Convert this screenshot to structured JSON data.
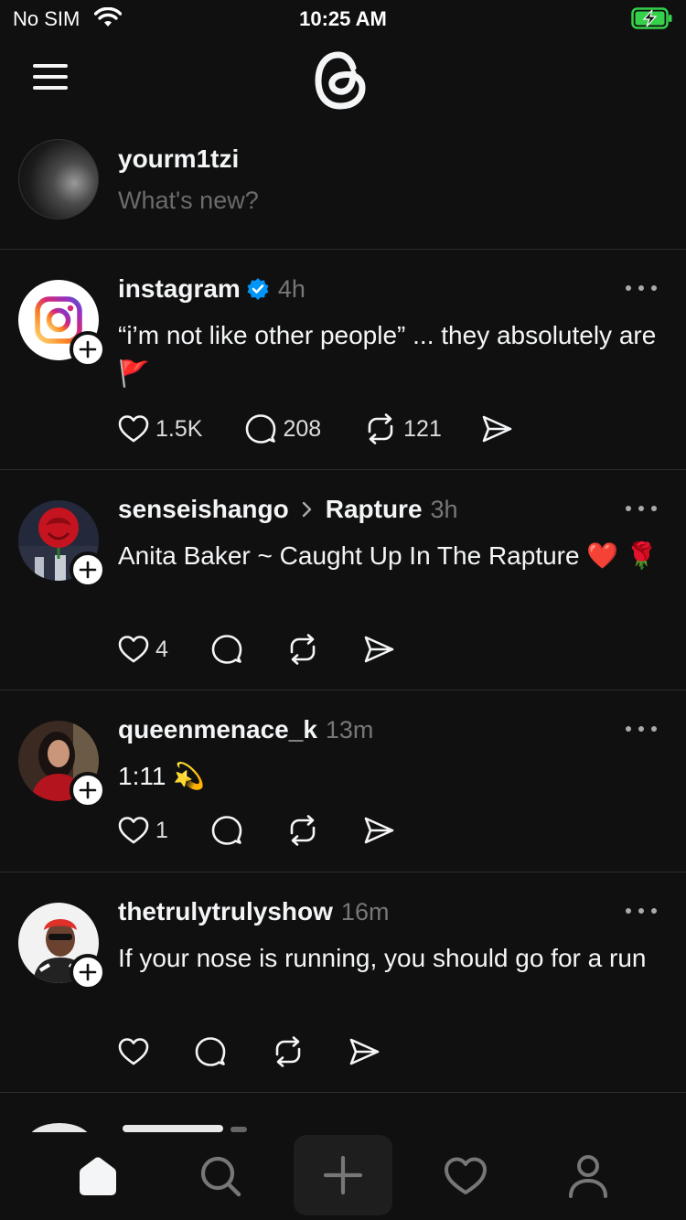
{
  "status_bar": {
    "carrier": "No SIM",
    "time": "10:25 AM"
  },
  "composer": {
    "username": "yourm1tzi",
    "placeholder": "What's new?"
  },
  "posts": [
    {
      "username": "instagram",
      "verified": true,
      "time": "4h",
      "body": "“i’m not like other people” ... they absolutely are 🚩",
      "likes": "1.5K",
      "replies": "208",
      "reposts": "121"
    },
    {
      "username": "senseishango",
      "community": "Rapture",
      "time": "3h",
      "body": "Anita Baker ~ Caught Up In The Rapture ❤️ 🌹",
      "likes": "4"
    },
    {
      "username": "queenmenace_k",
      "time": "13m",
      "body": "1:11 💫",
      "likes": "1"
    },
    {
      "username": "thetrulytrulyshow",
      "time": "16m",
      "body": "If your nose is running, you should go for a run"
    }
  ],
  "colors": {
    "background": "#101010",
    "verified": "#0095f6",
    "secondary_text": "#777777"
  },
  "icons": [
    "menu-icon",
    "threads-logo",
    "heart-icon",
    "reply-icon",
    "repost-icon",
    "share-icon",
    "home-icon",
    "search-icon",
    "plus-icon",
    "activity-icon",
    "profile-icon"
  ]
}
